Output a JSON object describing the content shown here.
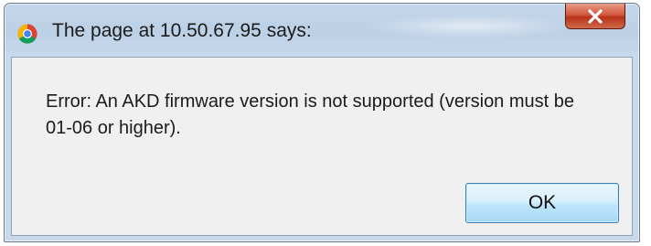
{
  "dialog": {
    "title": "The page at 10.50.67.95 says:",
    "message": "Error: An AKD firmware version is not supported (version must be 01-06 or higher).",
    "ok_label": "OK",
    "icons": {
      "app": "chrome-icon",
      "close": "close-icon"
    },
    "colors": {
      "frame": "#c4d6ea",
      "panel": "#f0f0f0",
      "close_button": "#c8452b",
      "ok_button": "#bee6fd"
    }
  }
}
